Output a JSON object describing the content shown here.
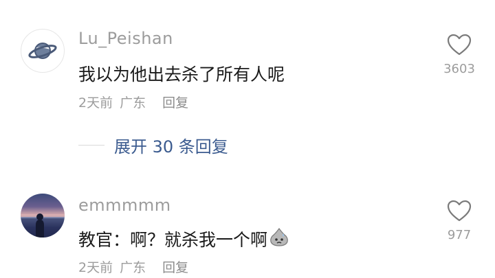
{
  "comments": [
    {
      "username": "Lu_Peishan",
      "avatar_icon": "planet-icon",
      "text": "我以为他出去杀了所有人呢",
      "time": "2天前",
      "location": "广东",
      "reply_label": "回复",
      "likes": "3603"
    },
    {
      "username": "emmmmm",
      "avatar_icon": "sea-sunset-photo",
      "text": "教官：啊？就杀我一个啊",
      "emoji": "sweat-emoji-icon",
      "time": "2天前",
      "location": "广东",
      "reply_label": "回复",
      "likes": "977"
    }
  ],
  "expand_replies": {
    "label": "展开 30 条回复"
  },
  "colors": {
    "username": "#9c9c9c",
    "text": "#1a1a1a",
    "link": "#3b5b8f",
    "meta": "#9c9c9c"
  }
}
